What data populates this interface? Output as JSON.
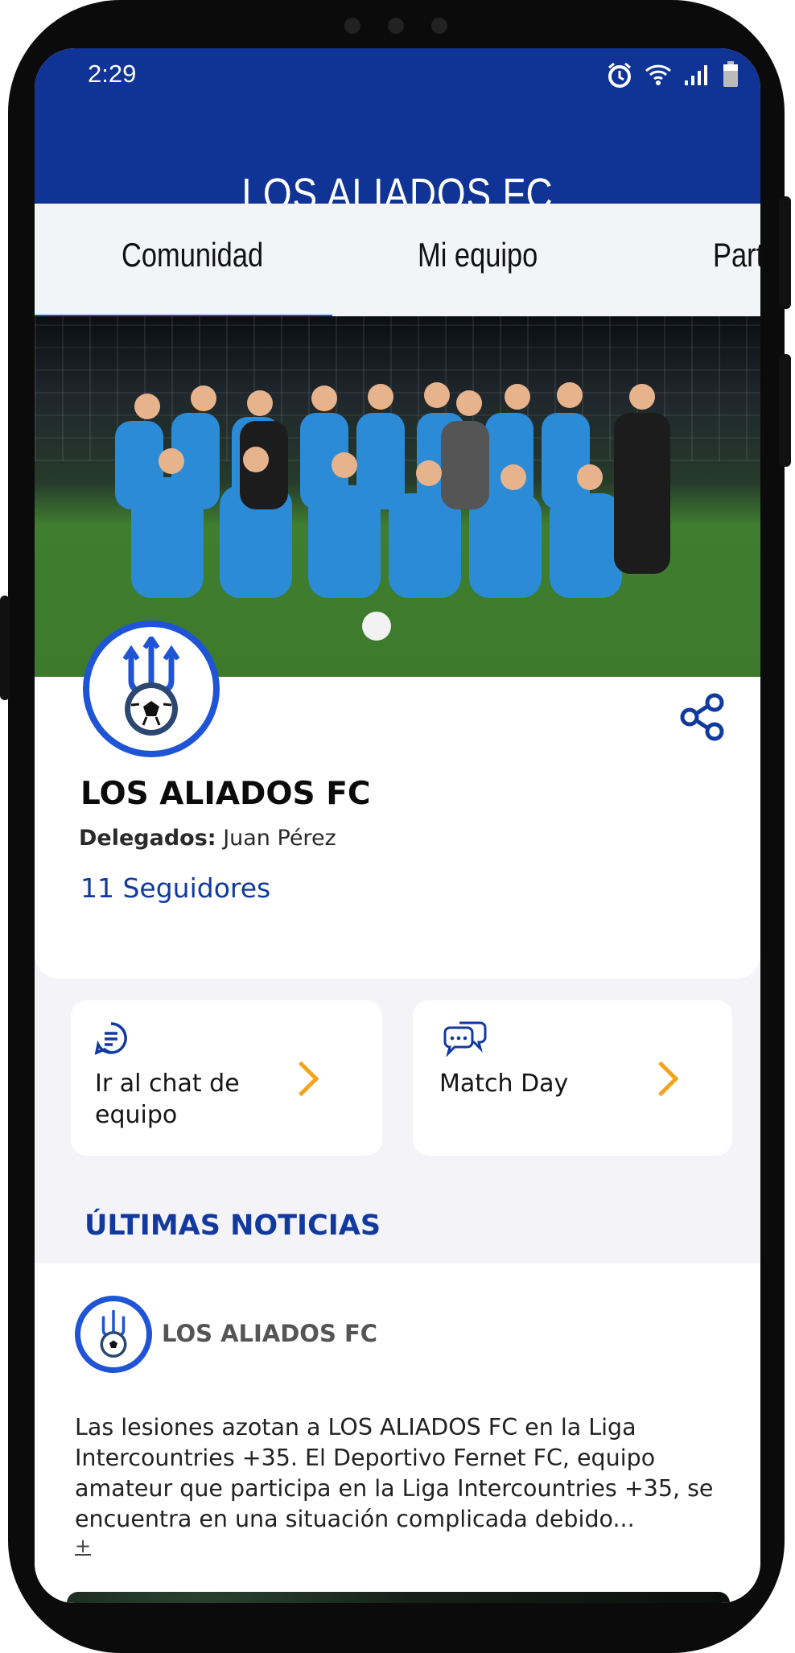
{
  "status_bar": {
    "time": "2:29"
  },
  "header": {
    "title": "LOS ALIADOS FC"
  },
  "tabs": [
    {
      "label": "Comunidad",
      "active": true
    },
    {
      "label": "Mi equipo",
      "active": false
    },
    {
      "label": "Part",
      "active": false
    }
  ],
  "team": {
    "name": "LOS ALIADOS FC",
    "delegados_label": "Delegados:",
    "delegados_value": "Juan Pérez",
    "followers": "11 Seguidores"
  },
  "actions": [
    {
      "label": "Ir al chat de equipo",
      "icon": "chat-document-icon"
    },
    {
      "label": "Match Day",
      "icon": "chat-bubbles-icon"
    }
  ],
  "news_section": {
    "title": "ÚLTIMAS NOTICIAS"
  },
  "news_item": {
    "author": "LOS ALIADOS FC",
    "body": "Las lesiones azotan a LOS ALIADOS FC en la Liga Intercountries +35. El Deportivo Fernet FC, equipo amateur que participa en la Liga Intercountries +35, se encuentra en una situación complicada debido...",
    "more": "+"
  },
  "colors": {
    "primary": "#103495",
    "accent": "#1f54d6",
    "chevron": "#f4a41c"
  }
}
